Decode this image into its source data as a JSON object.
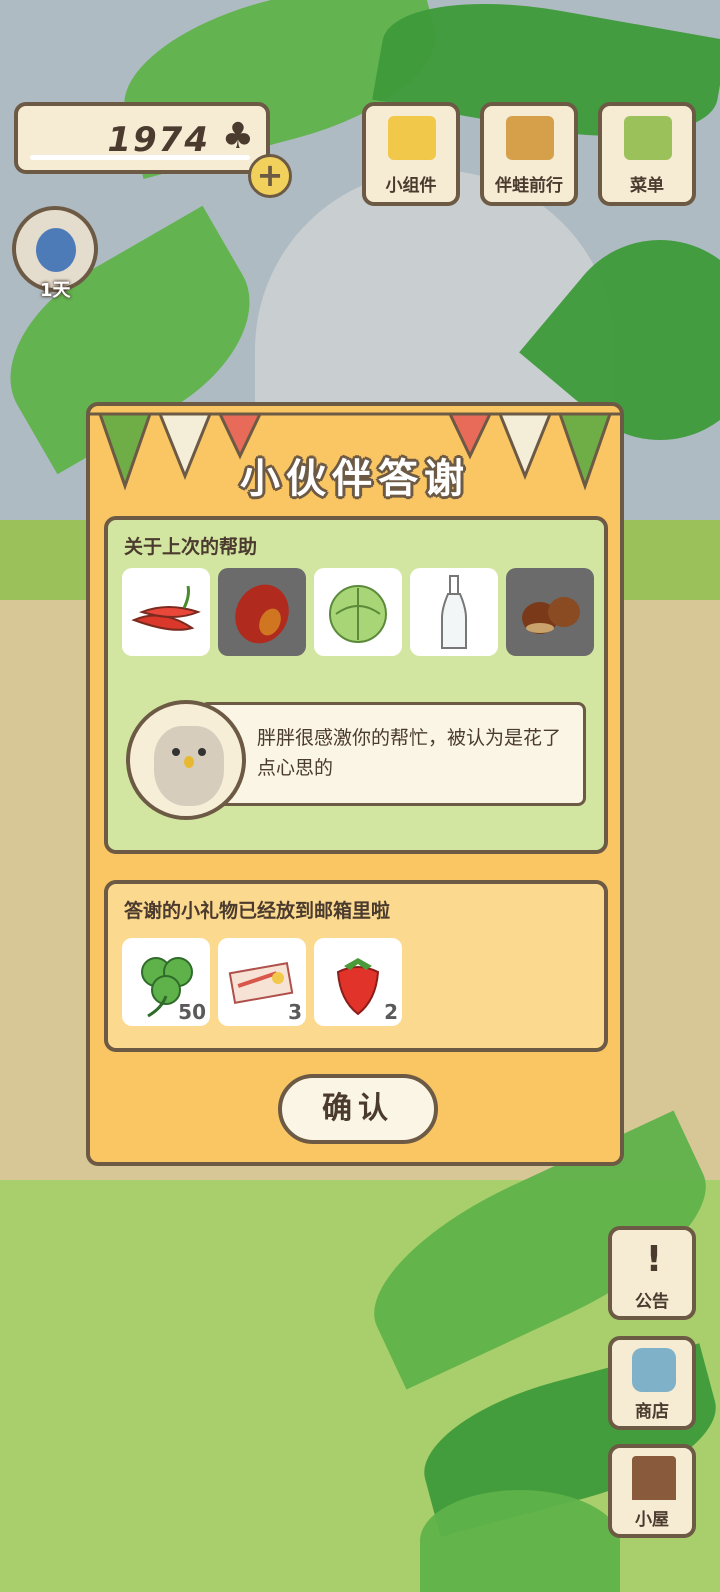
{
  "hud": {
    "clover_count": "1974",
    "clover_symbol": "♣",
    "add_symbol": "+",
    "visitor_day": "1天"
  },
  "top_menu": [
    {
      "label": "小组件",
      "icon": "widget-icon"
    },
    {
      "label": "伴蛙前行",
      "icon": "journal-icon"
    },
    {
      "label": "菜单",
      "icon": "menu-icon"
    }
  ],
  "side_menu": [
    {
      "label": "公告",
      "icon": "exclamation-icon",
      "glyph": "!"
    },
    {
      "label": "商店",
      "icon": "shop-bag-icon",
      "glyph": ""
    },
    {
      "label": "小屋",
      "icon": "house-icon",
      "glyph": ""
    }
  ],
  "dialog": {
    "title": "小伙伴答谢",
    "help_caption": "关于上次的帮助",
    "help_items": [
      {
        "icon": "chili-pepper-icon",
        "owned": true
      },
      {
        "icon": "mango-icon",
        "owned": false
      },
      {
        "icon": "cabbage-icon",
        "owned": true
      },
      {
        "icon": "glass-bottle-icon",
        "owned": true
      },
      {
        "icon": "chestnut-icon",
        "owned": false
      }
    ],
    "message": "胖胖很感激你的帮忙，被认为是花了点心思的",
    "gift_caption": "答谢的小礼物已经放到邮箱里啦",
    "gifts": [
      {
        "icon": "clover-icon",
        "qty": "50"
      },
      {
        "icon": "ticket-icon",
        "qty": "3"
      },
      {
        "icon": "strawberry-icon",
        "qty": "2"
      }
    ],
    "confirm_label": "确认"
  },
  "colors": {
    "dialog_bg": "#f9c663",
    "panel_green": "#d3e6a1",
    "panel_yellow": "#fbd98e",
    "outline": "#6d5a45"
  }
}
